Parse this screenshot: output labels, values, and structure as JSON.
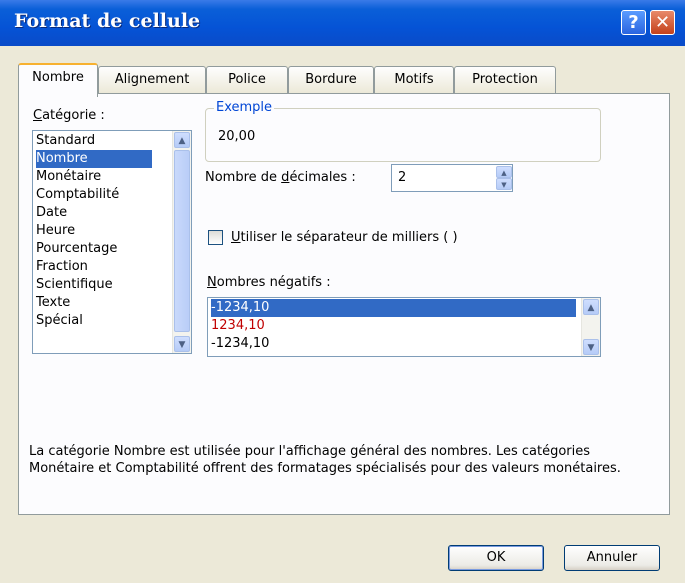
{
  "window": {
    "title": "Format de cellule",
    "help_label": "?",
    "close_label": "✕"
  },
  "tabs": [
    {
      "label": "Nombre",
      "active": true
    },
    {
      "label": "Alignement"
    },
    {
      "label": "Police"
    },
    {
      "label": "Bordure"
    },
    {
      "label": "Motifs"
    },
    {
      "label": "Protection"
    }
  ],
  "category": {
    "label_c": "C",
    "label_rest": "atégorie :",
    "items": [
      "Standard",
      "Nombre",
      "Monétaire",
      "Comptabilité",
      "Date",
      "Heure",
      "Pourcentage",
      "Fraction",
      "Scientifique",
      "Texte",
      "Spécial"
    ],
    "selected": "Nombre"
  },
  "example": {
    "label": "Exemple",
    "value": "20,00"
  },
  "decimals": {
    "label_pre": "Nombre de ",
    "label_u": "d",
    "label_post": "écimales :",
    "value": "2"
  },
  "thousands": {
    "label_u": "U",
    "label_rest": "tiliser le séparateur de milliers ( )",
    "checked": false
  },
  "negatives": {
    "label_u": "N",
    "label_rest": "ombres négatifs :",
    "items": [
      {
        "text": "-1234,10",
        "color": "#000000",
        "selected": true
      },
      {
        "text": "1234,10",
        "color": "#c00000"
      },
      {
        "text": "-1234,10",
        "color": "#000000"
      }
    ]
  },
  "description": "La catégorie Nombre est utilisée pour l'affichage général des nombres. Les catégories Monétaire et Comptabilité offrent des formatages spécialisés pour des valeurs monétaires.",
  "buttons": {
    "ok": "OK",
    "cancel": "Annuler"
  },
  "colors": {
    "titlebar": "#0553d6",
    "selection": "#316ac5",
    "group_label": "#0046d5",
    "negative_red": "#c00000"
  }
}
